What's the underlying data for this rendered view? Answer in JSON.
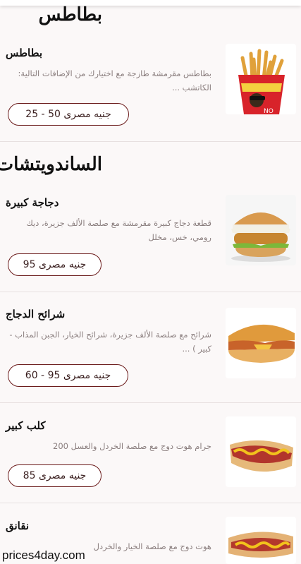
{
  "sections": {
    "fries": {
      "title": "بطاطس",
      "items": [
        {
          "name": "بطاطس",
          "desc": "بطاطس مقرمشة طازجة مع اختيارك من الإضافات التالية: الكاتشب ...",
          "price": "جنيه مصرى 50 - 25",
          "image": "french-fries-image"
        }
      ]
    },
    "sandwiches": {
      "title": "الساندويتشات",
      "items": [
        {
          "name": "دجاجة كبيرة",
          "desc": "قطعة دجاج كبيرة مقرمشة مع صلصة الألف جزيرة، ديك رومي، خس، مخلل",
          "price": "جنيه مصرى 95",
          "image": "chicken-burger-image"
        },
        {
          "name": "شرائح الدجاج",
          "desc": "شرائح مع صلصة الألف جزيرة، شرائح الخيار، الجبن المذاب - كبير ) ...",
          "price": "جنيه مصرى 95 - 60",
          "image": "chicken-strips-sandwich-image"
        },
        {
          "name": "كلب كبير",
          "desc": "جرام هوت دوج مع صلصة الخردل والعسل 200",
          "price": "جنيه مصرى 85",
          "image": "hot-dog-image"
        },
        {
          "name": "نقانق",
          "desc": "هوت دوج مع صلصة الخيار والخردل",
          "image": "sausage-image"
        }
      ]
    }
  },
  "watermark": "prices4day.com",
  "colors": {
    "background": "#fbf8f8",
    "price_border": "#6b1b1b",
    "description": "#8b7f7f"
  }
}
